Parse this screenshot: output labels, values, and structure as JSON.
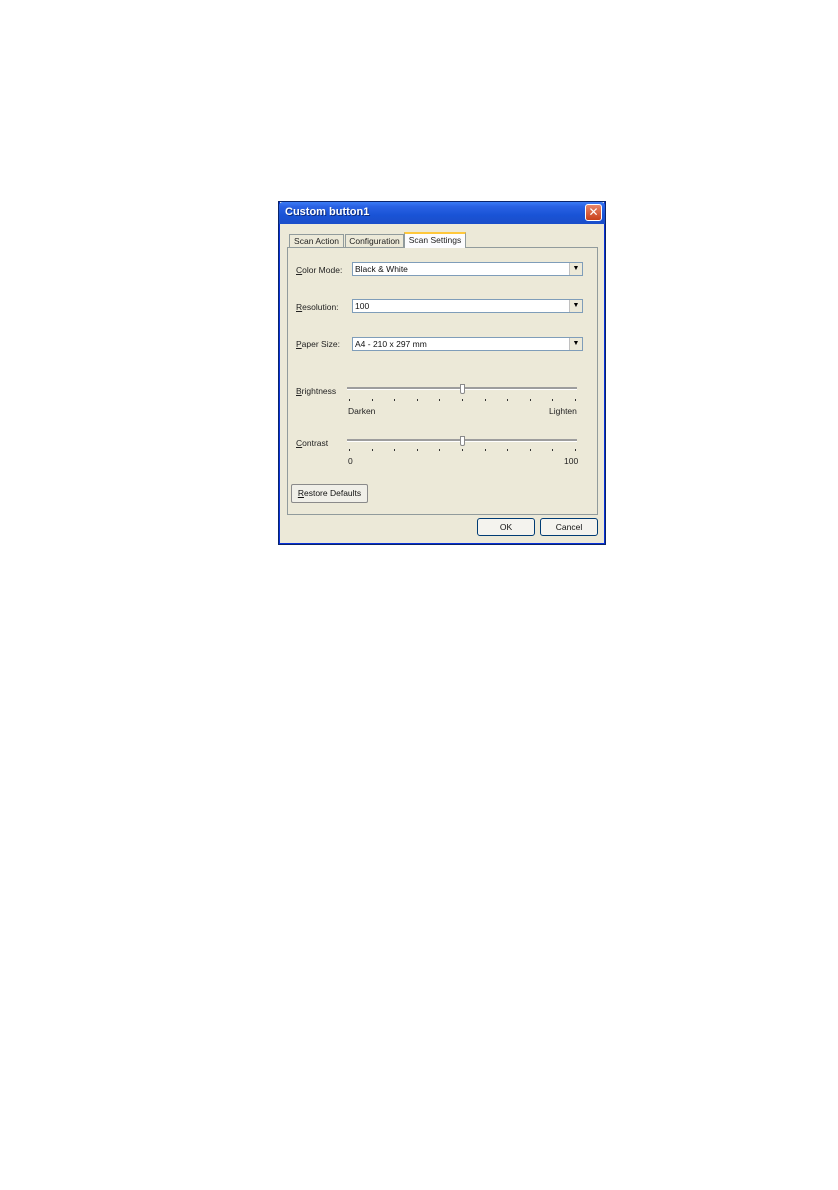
{
  "dialog": {
    "title": "Custom button1",
    "close_glyph": "✕",
    "close_icon": "close-icon"
  },
  "tabs": [
    {
      "label": "Scan Action"
    },
    {
      "label": "Configuration"
    },
    {
      "label": "Scan Settings",
      "active": true
    }
  ],
  "settings": {
    "color_mode": {
      "accel": "C",
      "rest": "olor Mode:",
      "value": "Black & White"
    },
    "resolution": {
      "accel": "R",
      "rest": "esolution:",
      "value": "100"
    },
    "paper_size": {
      "accel": "P",
      "rest": "aper Size:",
      "value": "A4 - 210 x 297 mm"
    },
    "dropdown_glyph": "▼"
  },
  "brightness": {
    "accel": "B",
    "rest": "rightness",
    "min_label": "Darken",
    "max_label": "Lighten",
    "level": 0.5
  },
  "contrast": {
    "accel": "C",
    "rest": "ontrast",
    "min_label": "0",
    "max_label": "100",
    "level": 0.5
  },
  "buttons": {
    "restore_accel": "R",
    "restore_rest": "estore Defaults",
    "ok": "OK",
    "cancel": "Cancel"
  }
}
